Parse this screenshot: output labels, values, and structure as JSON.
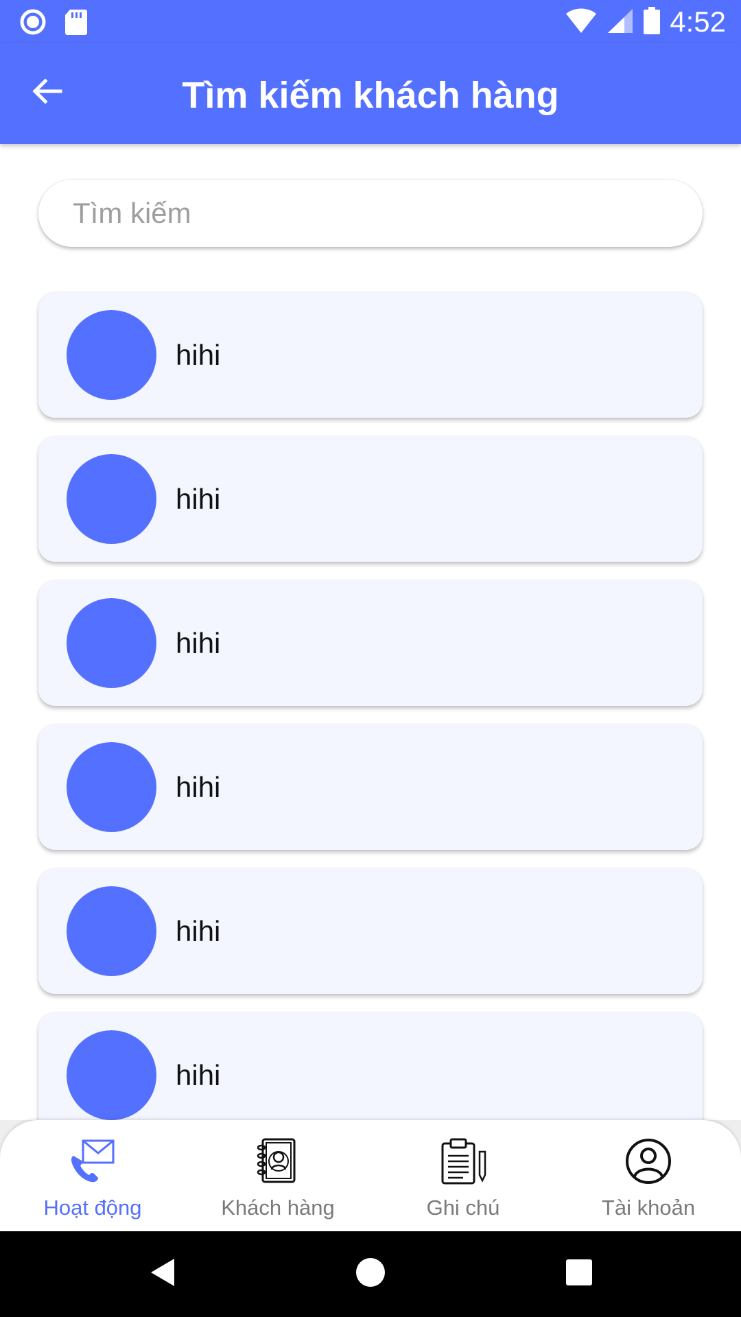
{
  "status_bar": {
    "time": "4:52",
    "icons": [
      "record-icon",
      "sd-card-icon",
      "wifi-icon",
      "signal-icon",
      "battery-icon"
    ]
  },
  "app_bar": {
    "title": "Tìm kiếm khách hàng",
    "back_icon": "arrow-left-icon"
  },
  "search": {
    "placeholder": "Tìm kiếm",
    "value": ""
  },
  "customers": [
    {
      "name": "hihi"
    },
    {
      "name": "hihi"
    },
    {
      "name": "hihi"
    },
    {
      "name": "hihi"
    },
    {
      "name": "hihi"
    },
    {
      "name": "hihi"
    }
  ],
  "bottom_nav": {
    "items": [
      {
        "label": "Hoạt động",
        "icon": "phone-mail-icon",
        "active": true
      },
      {
        "label": "Khách hàng",
        "icon": "contact-book-icon",
        "active": false
      },
      {
        "label": "Ghi chú",
        "icon": "clipboard-note-icon",
        "active": false
      },
      {
        "label": "Tài khoản",
        "icon": "user-circle-icon",
        "active": false
      }
    ]
  },
  "system_nav": [
    "back-triangle-icon",
    "home-circle-icon",
    "recents-square-icon"
  ],
  "colors": {
    "primary": "#5470fe",
    "card_bg": "#f3f6fe",
    "inactive_label": "#7a7a7a"
  }
}
